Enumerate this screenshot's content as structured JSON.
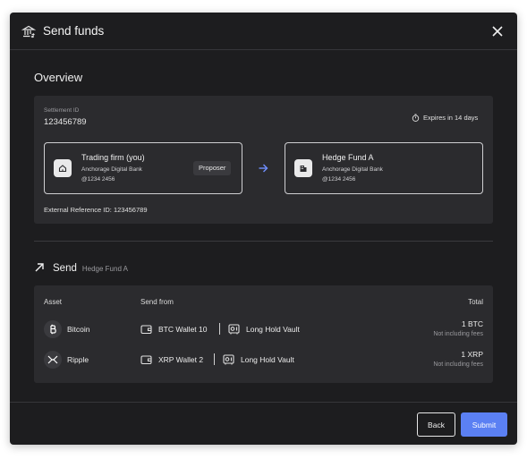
{
  "header": {
    "title": "Send funds",
    "icon": "bank-icon",
    "close_icon": "close-icon"
  },
  "overview": {
    "title": "Overview",
    "settlement_label": "Settlement ID",
    "settlement_id": "123456789",
    "expires": "Expires in 14 days",
    "proposer": {
      "name": "Trading firm (you)",
      "bank": "Anchorage Digital Bank",
      "account": "@1234 2456",
      "badge": "Proposer",
      "icon": "home-icon"
    },
    "counterparty": {
      "name": "Hedge Fund A",
      "bank": "Anchorage Digital Bank",
      "account": "@1234 2456",
      "icon": "building-icon"
    },
    "external_ref": "External Reference ID: 123456789"
  },
  "send": {
    "label": "Send",
    "to": "Hedge Fund A",
    "columns": {
      "asset": "Asset",
      "send_from": "Send from",
      "total": "Total"
    },
    "rows": [
      {
        "asset": "Bitcoin",
        "asset_icon": "bitcoin-icon",
        "wallet": "BTC Wallet 10",
        "vault": "Long Hold Vault",
        "total": "1 BTC",
        "fees_note": "Not including fees"
      },
      {
        "asset": "Ripple",
        "asset_icon": "ripple-icon",
        "wallet": "XRP Wallet 2",
        "vault": "Long Hold Vault",
        "total": "1 XRP",
        "fees_note": "Not including fees"
      }
    ]
  },
  "footer": {
    "back_label": "Back",
    "submit_label": "Submit"
  },
  "colors": {
    "modal_bg": "#1d1d1f",
    "card_bg": "#2b2b2e",
    "accent": "#5b80f3",
    "arrow_accent": "#6f8fff"
  }
}
